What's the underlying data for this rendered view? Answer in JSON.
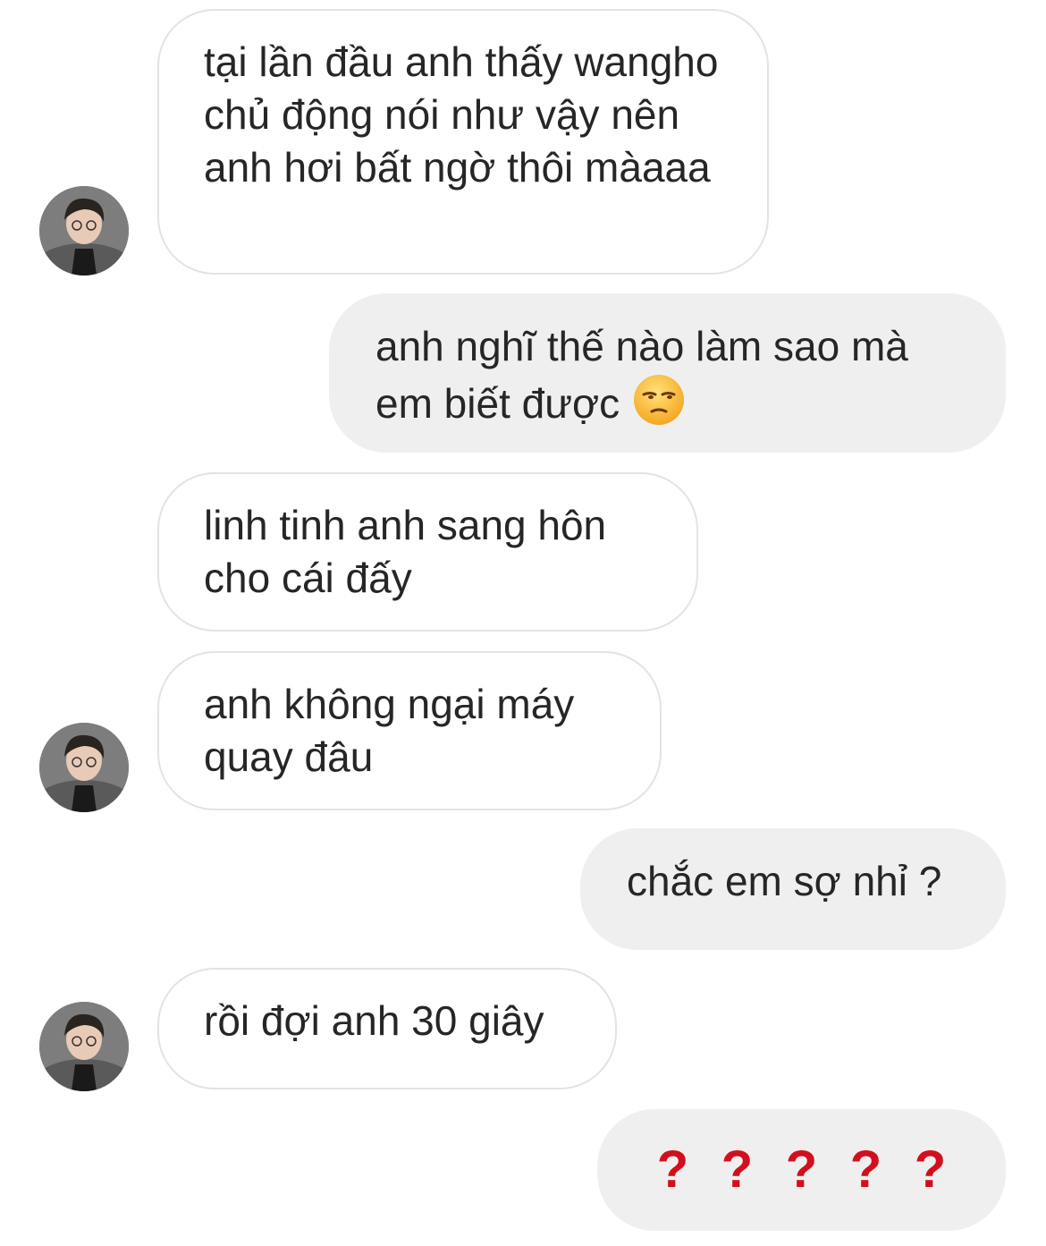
{
  "messages": [
    {
      "from": "other",
      "text": "tại lần đầu anh thấy wangho chủ động nói như vậy nên anh hơi bất ngờ thôi màaaa"
    },
    {
      "from": "me",
      "text": "anh nghĩ thế nào làm sao mà em biết được",
      "emoji": "unamused-face"
    },
    {
      "from": "other",
      "text": "linh tinh anh sang hôn cho cái đấy"
    },
    {
      "from": "other",
      "text": "anh không ngại máy quay đâu"
    },
    {
      "from": "me",
      "text": "chắc em sợ nhỉ ?"
    },
    {
      "from": "other",
      "text": "rồi đợi anh 30 giây"
    },
    {
      "from": "me",
      "marks": [
        "?",
        "?",
        "?",
        "?",
        "?"
      ],
      "color": "#d20f1c"
    }
  ],
  "colors": {
    "incoming_bg": "#ffffff",
    "incoming_border": "#e3e3e3",
    "outgoing_bg": "#efefef",
    "text": "#262626"
  },
  "icons": {
    "avatar": "profile-photo"
  }
}
